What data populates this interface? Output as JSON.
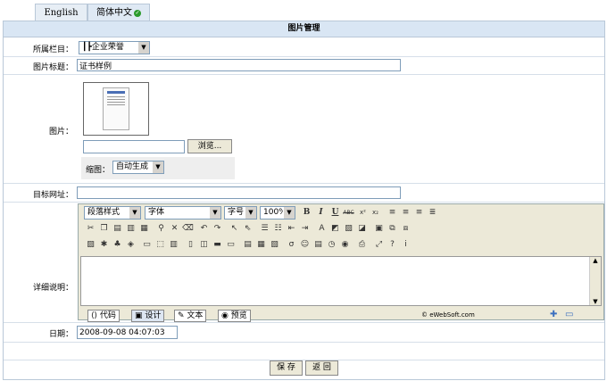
{
  "tabs": [
    {
      "label": "English"
    },
    {
      "label": "简体中文"
    }
  ],
  "panel": {
    "title": "图片管理"
  },
  "form": {
    "column_label": "所属栏目：",
    "column_value": "┃┣企业荣誉",
    "title_label": "图片标题：",
    "title_value": "证书样例",
    "image_label": "图片：",
    "browse_label": "浏览...",
    "thumb_label": "缩图：",
    "thumb_value": "自动生成",
    "url_label": "目标网址：",
    "url_value": "",
    "desc_label": "详细说明：",
    "date_label": "日期：",
    "date_value": "2008-09-08 04:07:03",
    "save_label": "保 存",
    "back_label": "返 回"
  },
  "editor": {
    "style_select": "段落样式",
    "font_select": "字体",
    "size_select": "字号",
    "zoom_select": "100%",
    "mode_code": "代码",
    "mode_design": "设计",
    "mode_text": "文本",
    "mode_preview": "预览",
    "credit": "© eWebSoft.com"
  },
  "colors": {
    "header_bg": "#d9e6f4",
    "border": "#b9c8d8",
    "toolbar_bg": "#ece9d8",
    "check": "#2a9a2a"
  }
}
